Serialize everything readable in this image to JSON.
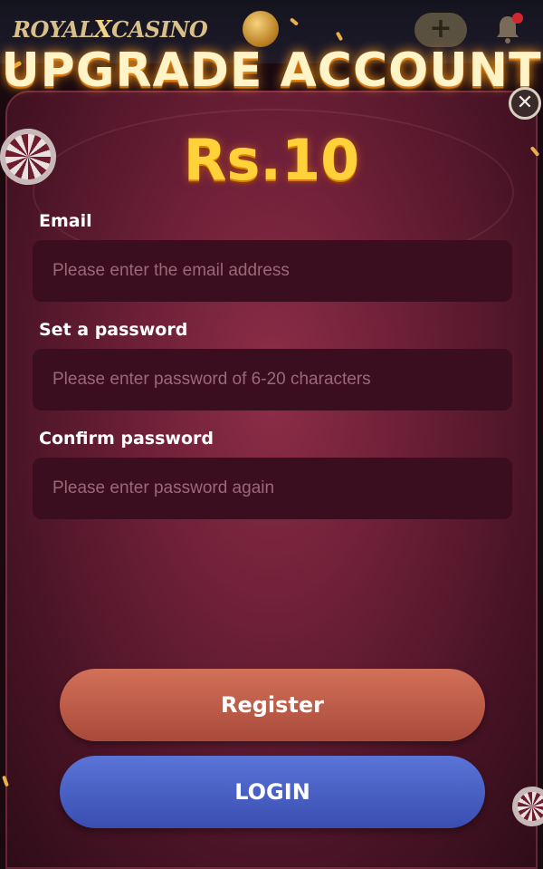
{
  "app": {
    "logo_left": "ROYAL",
    "logo_x": "X",
    "logo_right": "CASINO",
    "plus_label": "+"
  },
  "modal": {
    "title": "UPGRADE ACCOUNT",
    "amount": "Rs.10",
    "close_label": "✕"
  },
  "form": {
    "email_label": "Email",
    "email_placeholder": "Please enter the email address",
    "password_label": "Set a password",
    "password_placeholder": "Please enter password of 6-20 characters",
    "confirm_label": "Confirm password",
    "confirm_placeholder": "Please enter password again"
  },
  "actions": {
    "register_label": "Register",
    "login_label": "LOGIN"
  },
  "colors": {
    "accent_gold": "#ffd23a",
    "register_button": "#c0604a",
    "login_button": "#4a62c8",
    "modal_bg": "#6e2038"
  },
  "icons": [
    "coin-icon",
    "plus-icon",
    "bell-icon",
    "close-icon",
    "poker-chip-icon"
  ]
}
